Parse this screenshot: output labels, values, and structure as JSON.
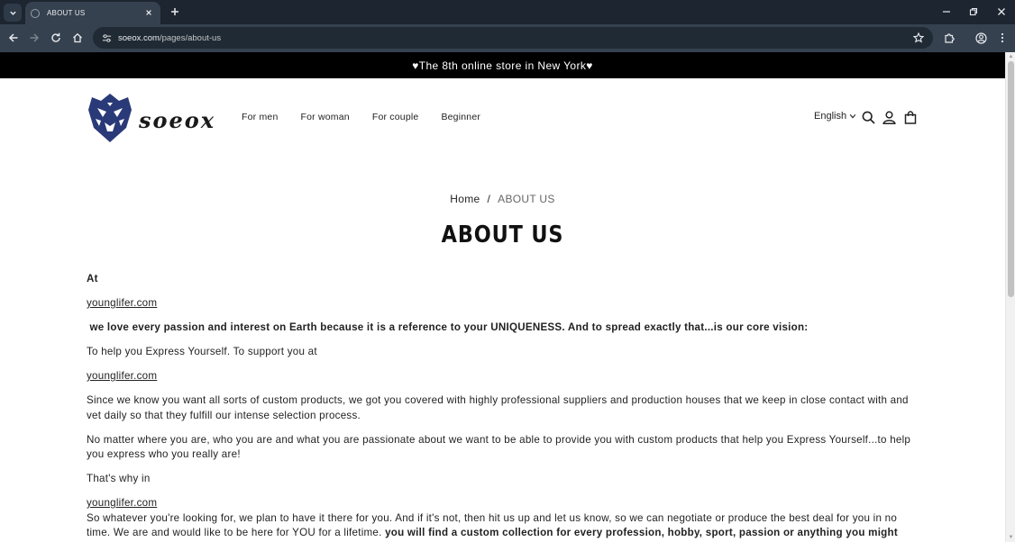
{
  "browser": {
    "tab_title": "ABOUT US",
    "url_host": "soeox.com",
    "url_path": "/pages/about-us",
    "icons": {
      "tab_menu": "chevron-down-icon",
      "close_tab": "close-icon",
      "new_tab": "plus-icon",
      "minimize": "minimize-icon",
      "restore": "restore-icon",
      "close_window": "close-icon",
      "back": "back-arrow-icon",
      "forward": "forward-arrow-icon",
      "reload": "reload-icon",
      "home": "home-icon",
      "site_info": "tune-icon",
      "bookmark": "star-icon",
      "extensions": "puzzle-icon",
      "profile": "account-icon",
      "menu": "kebab-menu-icon"
    },
    "colors": {
      "tabbar": "#1c2530",
      "toolbar": "#35414f",
      "omnibox": "#202a35"
    }
  },
  "announcement": {
    "text": "♥The 8th online store in New York♥"
  },
  "header": {
    "logo_text": "soeox",
    "nav": [
      "For men",
      "For woman",
      "For couple",
      "Beginner"
    ],
    "language": "English",
    "icons": {
      "search": "search-icon",
      "account": "user-icon",
      "cart": "shopping-bag-icon",
      "language_caret": "chevron-down-icon"
    }
  },
  "breadcrumb": {
    "home": "Home",
    "separator": "/",
    "current": "ABOUT US"
  },
  "page_title": "ABOUT US",
  "content": {
    "p1": "At",
    "link1": "younglifer.com",
    "p2": " we love every passion and interest on Earth because it is a reference to your UNIQUENESS. And to spread exactly that...is our core vision:",
    "p3": "To help you Express Yourself. To support you at",
    "link2": "younglifer.com",
    "p4": "Since we know you want all sorts of custom products, we got you covered with highly professional suppliers and production houses that we keep in close contact with and vet daily so that they fulfill our intense selection process.",
    "p5": "No matter where you are, who you are and what you are passionate about we want to be able to provide you with custom products that help you Express Yourself...to help you express who you really are!",
    "p6": "That's why in",
    "link3": "younglifer.com",
    "p7_normal": "So whatever you're looking for, we plan to have it there for you. And if it's not, then hit us up and let us know, so we can negotiate or produce the best deal for you in no time. We are and would like to be here for YOU for a lifetime. ",
    "p7_bold": "you will find a custom collection for every profession, hobby, sport, passion or anything you might think of."
  }
}
